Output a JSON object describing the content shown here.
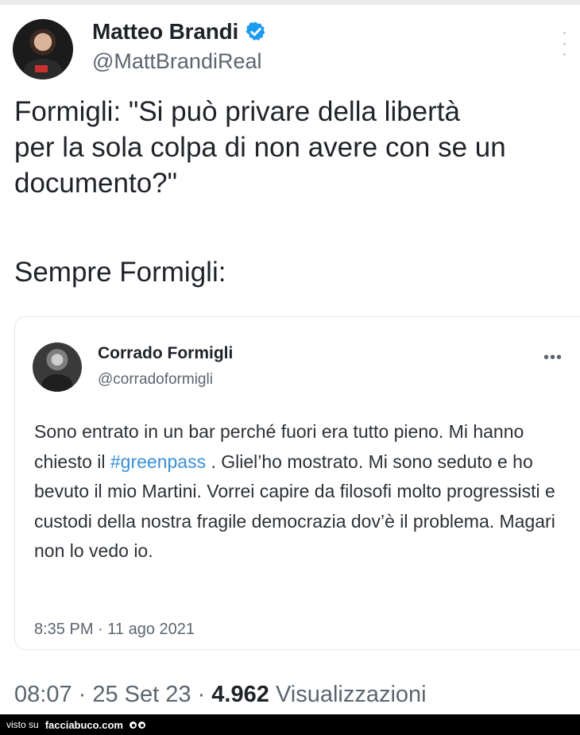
{
  "tweet": {
    "author_name": "Matteo Brandi",
    "author_handle": "@MattBrandiReal",
    "text_part1": "Formigli: \"Si può privare della libertà\nper la sola colpa di non avere con se un\ndocumento?\"",
    "text_part2": "Sempre Formigli:",
    "time": "08:07",
    "date": "25 Set 23",
    "views_count": "4.962",
    "views_label": "Visualizzazioni"
  },
  "quoted_tweet": {
    "author_name": "Corrado Formigli",
    "author_handle": "@corradoformigli",
    "text_before_hashtag": "Sono entrato in un bar perché fuori era tutto pieno. Mi hanno chiesto il ",
    "hashtag": "#greenpass",
    "text_after_hashtag": " . Gliel’ho mostrato. Mi sono seduto e ho bevuto il mio Martini. Vorrei capire da filosofi molto progressisti e custodi della nostra fragile democrazia dov’è il problema. Magari non lo vedo io.",
    "timestamp": "8:35 PM · 11 ago 2021",
    "more_icon": "more-horizontal-icon"
  },
  "footer": {
    "visto_label": "visto su",
    "site_label": "facciabuco.com"
  },
  "icons": {
    "verified": "verified-badge-icon",
    "more": "more-vertical-icon"
  },
  "colors": {
    "hashtag": "#3a8fd6",
    "verified": "#1d9bf0",
    "footer_bg": "#000000"
  }
}
